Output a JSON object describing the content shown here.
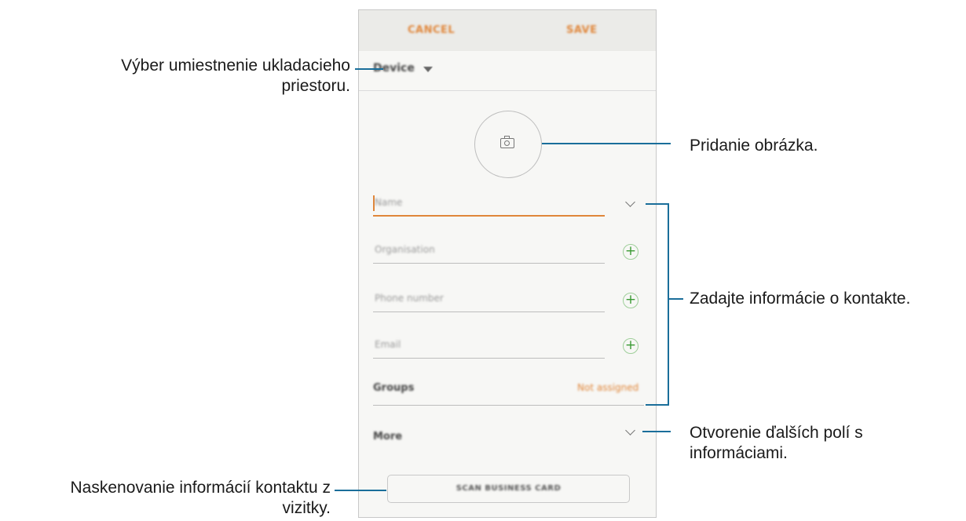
{
  "phone": {
    "cancel_label": "CANCEL",
    "save_label": "SAVE",
    "storage_label": "Device",
    "fields": {
      "name_placeholder": "Name",
      "organization_placeholder": "Organisation",
      "phone_placeholder": "Phone number",
      "email_placeholder": "Email"
    },
    "groups_label": "Groups",
    "groups_value": "Not assigned",
    "more_label": "More",
    "scan_button_label": "SCAN BUSINESS CARD",
    "add_icon": "+"
  },
  "annotations": {
    "storage_line1": "Výber umiestnenie ukladacieho",
    "storage_line2": "priestoru.",
    "picture": "Pridanie obrázka.",
    "contact_info": "Zadajte informácie o kontakte.",
    "more_line1": "Otvorenie ďalších polí s",
    "more_line2": "informáciami.",
    "scan_line1": "Naskenovanie informácií kontaktu z",
    "scan_line2": "vizitky."
  },
  "colors": {
    "accent": "#e0863a",
    "callout_line": "#1a6e9a",
    "add_green": "#3a9a33"
  },
  "icons": [
    "camera-icon",
    "chevron-down-icon",
    "plus-circle-icon",
    "dropdown-arrow-icon"
  ]
}
